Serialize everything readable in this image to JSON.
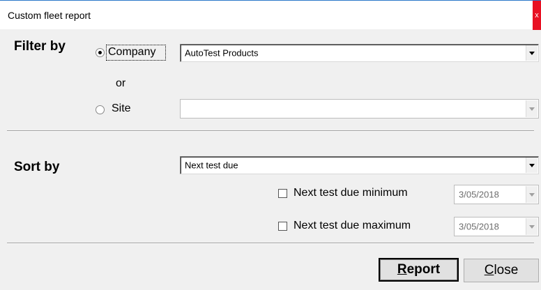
{
  "window": {
    "title": "Custom fleet report",
    "close_glyph": "x"
  },
  "filter": {
    "heading": "Filter by",
    "company_label": "Company",
    "company_selected": true,
    "company_value": "AutoTest Products",
    "or_text": "or",
    "site_label": "Site",
    "site_selected": false,
    "site_value": ""
  },
  "sort": {
    "heading": "Sort by",
    "value": "Next test due",
    "min_label": "Next test due minimum",
    "min_checked": false,
    "min_date": "3/05/2018",
    "max_label": "Next test due maximum",
    "max_checked": false,
    "max_date": "3/05/2018"
  },
  "buttons": {
    "report_first": "R",
    "report_rest": "eport",
    "close_first": "C",
    "close_rest": "lose"
  }
}
